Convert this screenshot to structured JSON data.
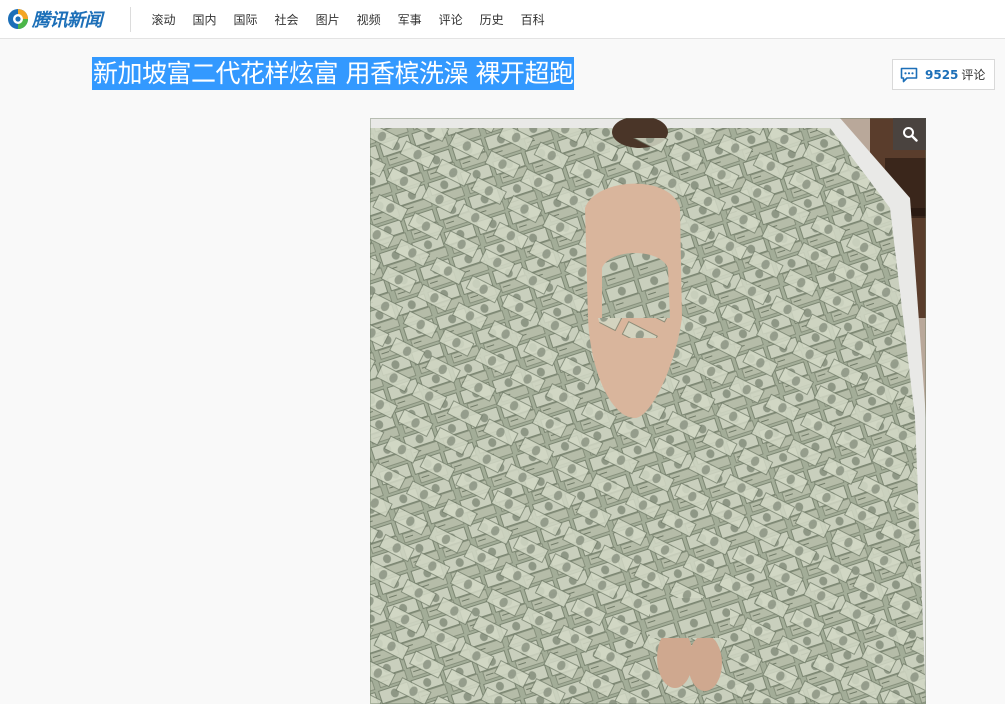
{
  "header": {
    "logo_text": "腾讯新闻",
    "nav": [
      {
        "label": "滚动"
      },
      {
        "label": "国内"
      },
      {
        "label": "国际"
      },
      {
        "label": "社会"
      },
      {
        "label": "图片"
      },
      {
        "label": "视频"
      },
      {
        "label": "军事"
      },
      {
        "label": "评论"
      },
      {
        "label": "历史"
      },
      {
        "label": "百科"
      }
    ]
  },
  "article": {
    "title": "新加坡富二代花样炫富 用香槟洗澡 裸开超跑",
    "comment_count": "9525",
    "comment_label": "评论"
  },
  "icons": {
    "logo": "tencent-news-logo",
    "comment": "speech-bubble-icon",
    "zoom": "magnifier-icon"
  },
  "colors": {
    "brand_blue": "#1c6fb8",
    "title_highlight": "#3399ff",
    "page_bg": "#f9f9f9"
  }
}
